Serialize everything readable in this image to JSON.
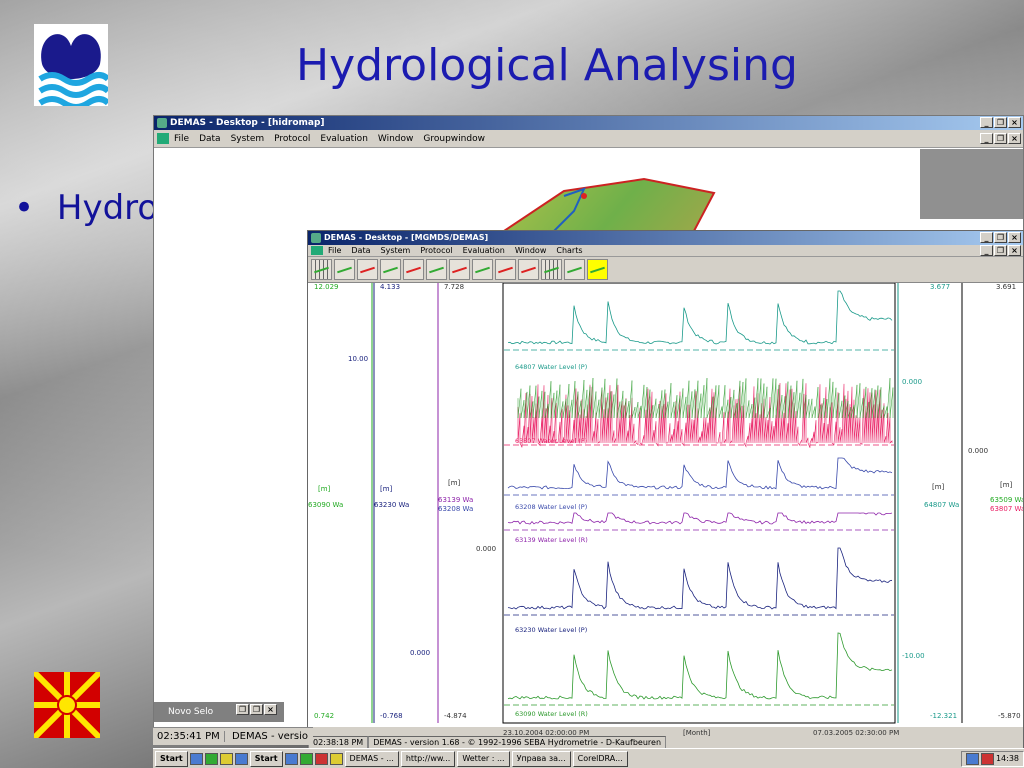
{
  "slide": {
    "title": "Hydrological Analysing",
    "bullet": "Hydrological Data;",
    "bullet_marker": "•"
  },
  "back_window": {
    "title": "DEMAS - Desktop - [hidromap]",
    "menu": [
      "File",
      "Data",
      "System",
      "Protocol",
      "Evaluation",
      "Window",
      "Groupwindow"
    ],
    "minimized_window": "Novo Selo",
    "status_time": "02:35:41 PM",
    "status_app": "DEMAS - versio"
  },
  "front_window": {
    "title": "DEMAS - Desktop - [MGMDS/DEMAS]",
    "menu": [
      "File",
      "Data",
      "System",
      "Protocol",
      "Evaluation",
      "Window",
      "Charts"
    ],
    "status_time": "02:38:18 PM",
    "status_app": "DEMAS - version 1.68 - © 1992-1996 SEBA Hydrometrie - D-Kaufbeuren"
  },
  "window_buttons": [
    "_",
    "❐",
    "×"
  ],
  "chart_data": {
    "type": "line",
    "x_start": "23.10.2004 02:00:00 PM",
    "x_end": "07.03.2005 02:30:00 PM",
    "x_label": "[Month]",
    "axes_left": [
      {
        "top": "12.029",
        "bottom": "0.742",
        "unit": "[m]",
        "series": "63090 Wa",
        "color": "#22aa22"
      },
      {
        "top": "4.133",
        "mid": "10.00",
        "lower": "0.000",
        "bottom": "-0.768",
        "unit": "[m]",
        "series": "63230 Wa",
        "color": "#1a237e"
      },
      {
        "top": "7.728",
        "mid": "0.000",
        "bottom": "-4.874",
        "unit": "[m]",
        "series": "63139 Wa",
        "series2": "63208 Wa",
        "color": "#8e24aa"
      }
    ],
    "axes_right": [
      {
        "top": "3.677",
        "mid": "0.000",
        "lower": "-10.00",
        "bottom": "-12.321",
        "unit": "[m]",
        "series": "64807 Wa",
        "color": "#1a9a8a"
      },
      {
        "top": "3.691",
        "mid": "0.000",
        "bottom": "-5.870",
        "unit": "[m]",
        "series": "63509 Wa",
        "series2": "63807 Wa",
        "color": "#e91e63"
      }
    ],
    "series": [
      {
        "name": "64807 Water Level (P)",
        "color": "#1a9a8a"
      },
      {
        "name": "63807 Water Level (P)",
        "color": "#e91e63"
      },
      {
        "name": "63208 Water Level (P)",
        "color": "#3949ab"
      },
      {
        "name": "63139 Water Level (R)",
        "color": "#8e24aa"
      },
      {
        "name": "63230 Water Level (P)",
        "color": "#1a237e"
      },
      {
        "name": "63090 Water Level (R)",
        "color": "#2e9a2e"
      }
    ]
  },
  "taskbar": {
    "start": "Start",
    "items": [
      "DEMAS - ...",
      "http://ww...",
      "Wetter : ...",
      "Управа за...",
      "CorelDRA..."
    ],
    "clock": "14:38"
  }
}
